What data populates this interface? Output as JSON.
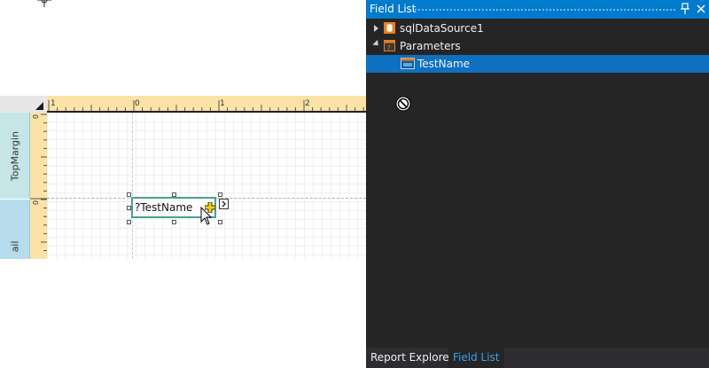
{
  "designer": {
    "bands": {
      "top_margin": "TopMargin",
      "detail": "ail"
    },
    "h_ruler_labels": [
      "1",
      "0",
      "1",
      "2"
    ],
    "v_ruler_labels": [
      "0",
      "0"
    ],
    "field_control": {
      "text": "?TestName"
    }
  },
  "field_list": {
    "title": "Field List",
    "tree": [
      {
        "label": "sqlDataSource1",
        "icon": "database-icon",
        "expanded": false
      },
      {
        "label": "Parameters",
        "icon": "parameters-icon",
        "expanded": true
      },
      {
        "label": "TestName",
        "icon": "parameter-field-icon",
        "selected": true
      }
    ],
    "tabs": [
      "Report Explorer",
      "Field List"
    ],
    "active_tab": "Field List"
  },
  "colors": {
    "accent": "#007acc",
    "selection": "#0e70c0",
    "panel_bg": "#252526",
    "ruler": "#fbe3a6",
    "band": "#bfe3ea",
    "control_border": "#4aa08f"
  }
}
